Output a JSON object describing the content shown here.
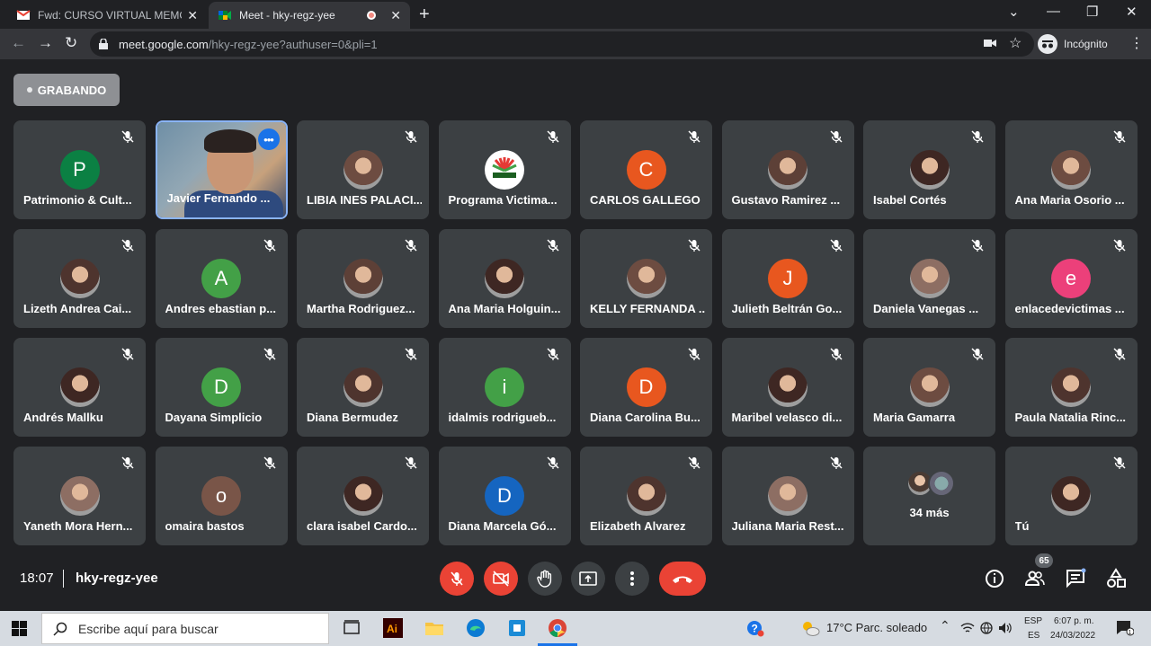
{
  "browser": {
    "tabs": [
      {
        "title": "Fwd: CURSO VIRTUAL MEMORIA",
        "icon": "gmail-icon"
      },
      {
        "title": "Meet - hky-regz-yee",
        "icon": "meet-icon",
        "active": true
      }
    ],
    "url_host": "meet.google.com",
    "url_path": "/hky-regz-yee?authuser=0&pli=1",
    "incognito_label": "Incógnito"
  },
  "meet": {
    "recording_label": "GRABANDO",
    "participants": [
      {
        "name": "Patrimonio & Cult...",
        "initial": "P",
        "color": "#0b8043",
        "type": "letter"
      },
      {
        "name": "Javier Fernando ...",
        "type": "video"
      },
      {
        "name": "LIBIA INES PALACI...",
        "type": "photo"
      },
      {
        "name": "Programa Victima...",
        "type": "logo"
      },
      {
        "name": "CARLOS GALLEGO",
        "initial": "C",
        "color": "#e8571f",
        "type": "letter"
      },
      {
        "name": "Gustavo Ramirez ...",
        "type": "photo"
      },
      {
        "name": "Isabel Cortés",
        "type": "photo"
      },
      {
        "name": "Ana Maria Osorio ...",
        "type": "photo"
      },
      {
        "name": "Lizeth Andrea Cai...",
        "type": "photo"
      },
      {
        "name": "Andres ebastian p...",
        "initial": "A",
        "color": "#43a047",
        "type": "letter"
      },
      {
        "name": "Martha Rodriguez...",
        "type": "photo"
      },
      {
        "name": "Ana Maria Holguin...",
        "type": "photo"
      },
      {
        "name": "KELLY FERNANDA ...",
        "type": "photo"
      },
      {
        "name": "Julieth Beltrán Go...",
        "initial": "J",
        "color": "#e8571f",
        "type": "letter"
      },
      {
        "name": "Daniela Vanegas ...",
        "type": "photo"
      },
      {
        "name": "enlacedevictimas ...",
        "initial": "e",
        "color": "#ec407a",
        "type": "letter"
      },
      {
        "name": "Andrés Mallku",
        "type": "photo"
      },
      {
        "name": "Dayana Simplicio",
        "initial": "D",
        "color": "#43a047",
        "type": "letter"
      },
      {
        "name": "Diana Bermudez",
        "type": "photo"
      },
      {
        "name": "idalmis rodrigueb...",
        "initial": "i",
        "color": "#43a047",
        "type": "letter"
      },
      {
        "name": "Diana Carolina Bu...",
        "initial": "D",
        "color": "#e8571f",
        "type": "letter"
      },
      {
        "name": "Maribel velasco di...",
        "type": "photo"
      },
      {
        "name": "Maria Gamarra",
        "type": "photo"
      },
      {
        "name": "Paula Natalia Rinc...",
        "type": "photo"
      },
      {
        "name": "Yaneth Mora Hern...",
        "type": "photo"
      },
      {
        "name": "omaira bastos",
        "initial": "o",
        "color": "#795548",
        "type": "letter"
      },
      {
        "name": "clara isabel Cardo...",
        "type": "photo"
      },
      {
        "name": "Diana Marcela Gó...",
        "initial": "D",
        "color": "#1565c0",
        "type": "letter"
      },
      {
        "name": "Elizabeth Alvarez",
        "type": "photo"
      },
      {
        "name": "Juliana Maria Rest...",
        "type": "photo"
      },
      {
        "name": "34 más",
        "type": "more"
      },
      {
        "name": "Tú",
        "type": "photo",
        "self": true
      }
    ]
  },
  "controls": {
    "time": "18:07",
    "meeting_code": "hky-regz-yee",
    "participant_count": "65"
  },
  "taskbar": {
    "search_placeholder": "Escribe aquí para buscar",
    "weather": "17°C  Parc. soleado",
    "lang_top": "ESP",
    "lang_bottom": "ES",
    "clock_time": "6:07 p. m.",
    "clock_date": "24/03/2022"
  },
  "colors": {
    "accent": "#8ab4f8",
    "danger": "#ea4335",
    "tile": "#3c4043",
    "background": "#202124"
  }
}
